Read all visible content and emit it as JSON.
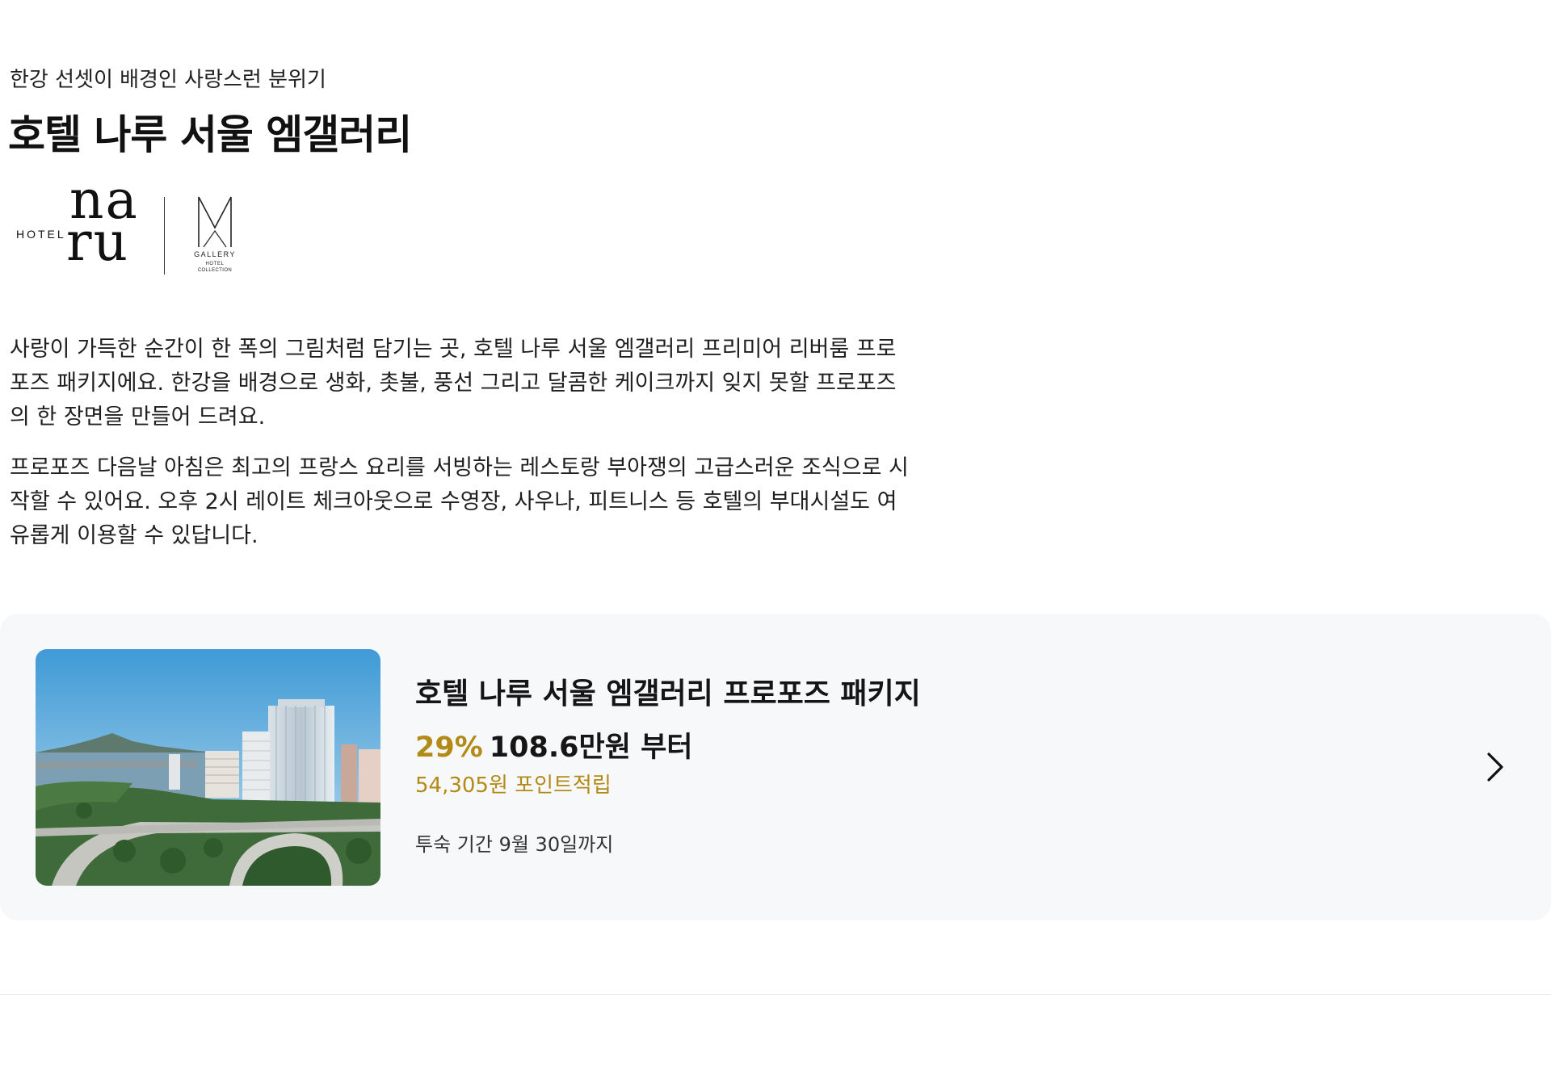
{
  "header": {
    "subtitle": "한강 선셋이 배경인 사랑스런 분위기",
    "title": "호텔 나루 서울 엠갤러리"
  },
  "logos": {
    "hotel_label": "HOTEL",
    "naru_line1": "na",
    "naru_line2": "ru",
    "mgallery_text": "GALLERY",
    "mgallery_sub1": "HOTEL",
    "mgallery_sub2": "COLLECTION"
  },
  "description": {
    "paragraph1": "사랑이 가득한 순간이 한 폭의 그림처럼 담기는 곳, 호텔 나루 서울 엠갤러리 프리미어 리버룸 프로포즈 패키지에요. 한강을 배경으로 생화, 촛불, 풍선 그리고 달콤한 케이크까지 잊지 못할 프로포즈의 한 장면을 만들어 드려요.",
    "paragraph2": "프로포즈 다음날 아침은 최고의 프랑스 요리를 서빙하는 레스토랑 부아쟁의 고급스러운 조식으로 시작할 수 있어요. 오후 2시 레이트 체크아웃으로 수영장, 사우나, 피트니스 등 호텔의 부대시설도 여유롭게 이용할 수 있답니다."
  },
  "package_card": {
    "title": "호텔 나루 서울 엠갤러리 프로포즈 패키지",
    "discount": "29%",
    "price": "108.6만원 부터",
    "points": "54,305원 포인트적립",
    "stay_period": "투숙 기간 9월 30일까지",
    "image_icon": "hotel-photo",
    "arrow_icon": "chevron-right-icon"
  },
  "colors": {
    "accent_gold": "#b38a16",
    "card_background": "#f7f8fa",
    "text_primary": "#151515"
  }
}
